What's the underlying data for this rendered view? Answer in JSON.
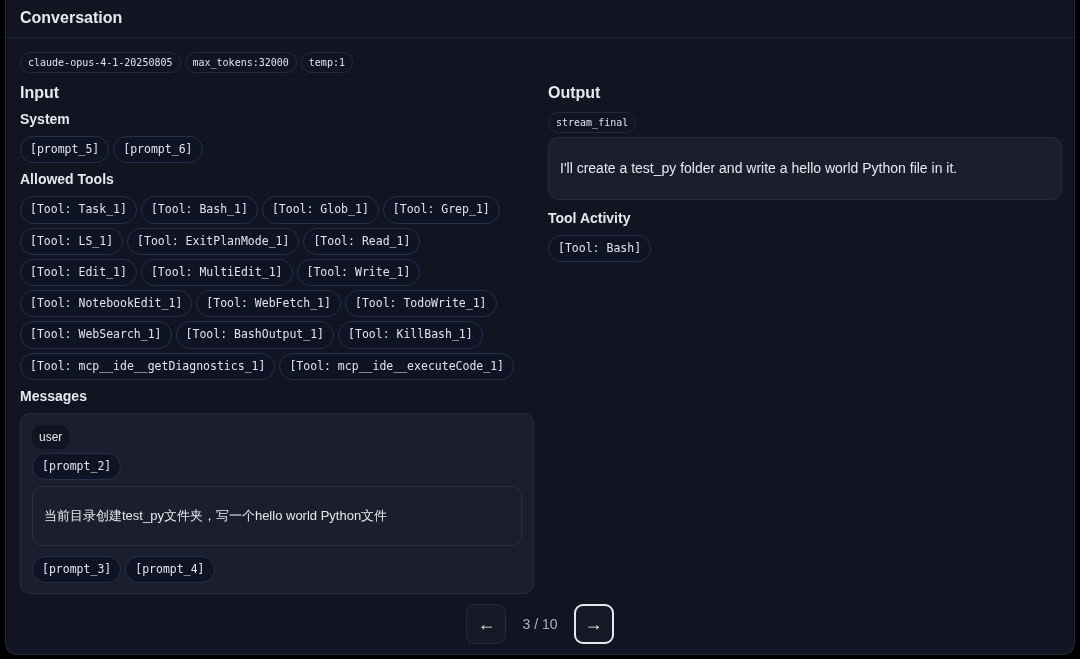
{
  "panel": {
    "title": "Conversation"
  },
  "meta_chips": [
    "claude-opus-4-1-20250805",
    "max_tokens:32000",
    "temp:1"
  ],
  "input": {
    "title": "Input",
    "system_title": "System",
    "system_chips": [
      "[prompt_5]",
      "[prompt_6]"
    ],
    "tools_title": "Allowed Tools",
    "tools": [
      "[Tool: Task_1]",
      "[Tool: Bash_1]",
      "[Tool: Glob_1]",
      "[Tool: Grep_1]",
      "[Tool: LS_1]",
      "[Tool: ExitPlanMode_1]",
      "[Tool: Read_1]",
      "[Tool: Edit_1]",
      "[Tool: MultiEdit_1]",
      "[Tool: Write_1]",
      "[Tool: NotebookEdit_1]",
      "[Tool: WebFetch_1]",
      "[Tool: TodoWrite_1]",
      "[Tool: WebSearch_1]",
      "[Tool: BashOutput_1]",
      "[Tool: KillBash_1]",
      "[Tool: mcp__ide__getDiagnostics_1]",
      "[Tool: mcp__ide__executeCode_1]"
    ],
    "messages_title": "Messages",
    "messages": [
      {
        "role": "user",
        "chips_before": [
          "[prompt_2]"
        ],
        "text": "当前目录创建test_py文件夹，写一个hello world Python文件",
        "chips_after": [
          "[prompt_3]",
          "[prompt_4]"
        ]
      }
    ]
  },
  "output": {
    "title": "Output",
    "mode": "stream_final",
    "text": "I'll create a test_py folder and write a hello world Python file in it.",
    "activity_title": "Tool Activity",
    "activity_chips": [
      "[Tool: Bash]"
    ]
  },
  "pager": {
    "prev": {
      "label": "←",
      "focused": false
    },
    "position": "3 / 10",
    "next": {
      "label": "→",
      "focused": true
    }
  }
}
